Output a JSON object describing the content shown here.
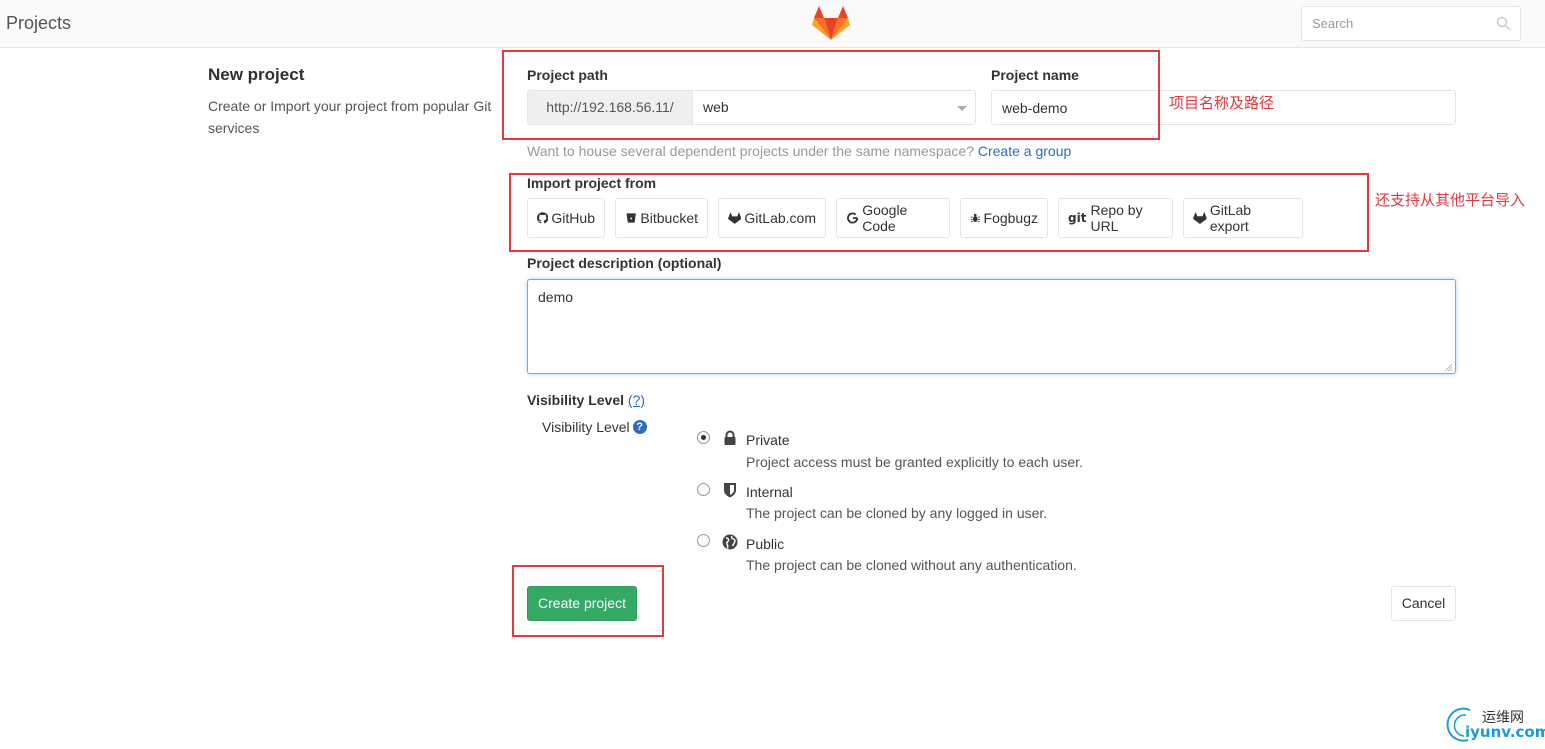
{
  "header": {
    "title": "Projects",
    "search_placeholder": "Search",
    "colors": {
      "logo_orange": "#e2432a",
      "logo_light": "#fca326"
    }
  },
  "intro": {
    "heading": "New project",
    "text": "Create or Import your project from popular Git services"
  },
  "form": {
    "project_path_label": "Project path",
    "path_prefix": "http://192.168.56.11/",
    "namespace_value": "web",
    "project_name_label": "Project name",
    "project_name_value": "web-demo",
    "help_text": "Want to house several dependent projects under the same namespace?",
    "help_link": "Create a group",
    "import_label": "Import project from",
    "import_sources": [
      {
        "label": "GitHub",
        "icon": "github-icon"
      },
      {
        "label": "Bitbucket",
        "icon": "bitbucket-icon"
      },
      {
        "label": "GitLab.com",
        "icon": "gitlab-icon"
      },
      {
        "label": "Google Code",
        "icon": "google-icon"
      },
      {
        "label": "Fogbugz",
        "icon": "bug-icon"
      },
      {
        "label": "Repo by URL",
        "icon": "git-icon",
        "icon_text": "git"
      },
      {
        "label": "GitLab export",
        "icon": "gitlab-icon"
      }
    ],
    "description_label": "Project description (optional)",
    "description_value": "demo",
    "visibility_label": "Visibility Level",
    "visibility_help": "(?)",
    "visibility_sub_label": "Visibility Level",
    "visibility_options": [
      {
        "title": "Private",
        "desc": "Project access must be granted explicitly to each user.",
        "icon": "lock-icon",
        "checked": true
      },
      {
        "title": "Internal",
        "desc": "The project can be cloned by any logged in user.",
        "icon": "shield-icon",
        "checked": false
      },
      {
        "title": "Public",
        "desc": "The project can be cloned without any authentication.",
        "icon": "globe-icon",
        "checked": false
      }
    ],
    "create_label": "Create project",
    "cancel_label": "Cancel"
  },
  "annotations": {
    "name_path_note": "项目名称及路径",
    "import_note": "还支持从其他平台导入",
    "color": "#e0393e"
  },
  "watermark": {
    "cn": "运维网",
    "en": "iyunv.com"
  }
}
